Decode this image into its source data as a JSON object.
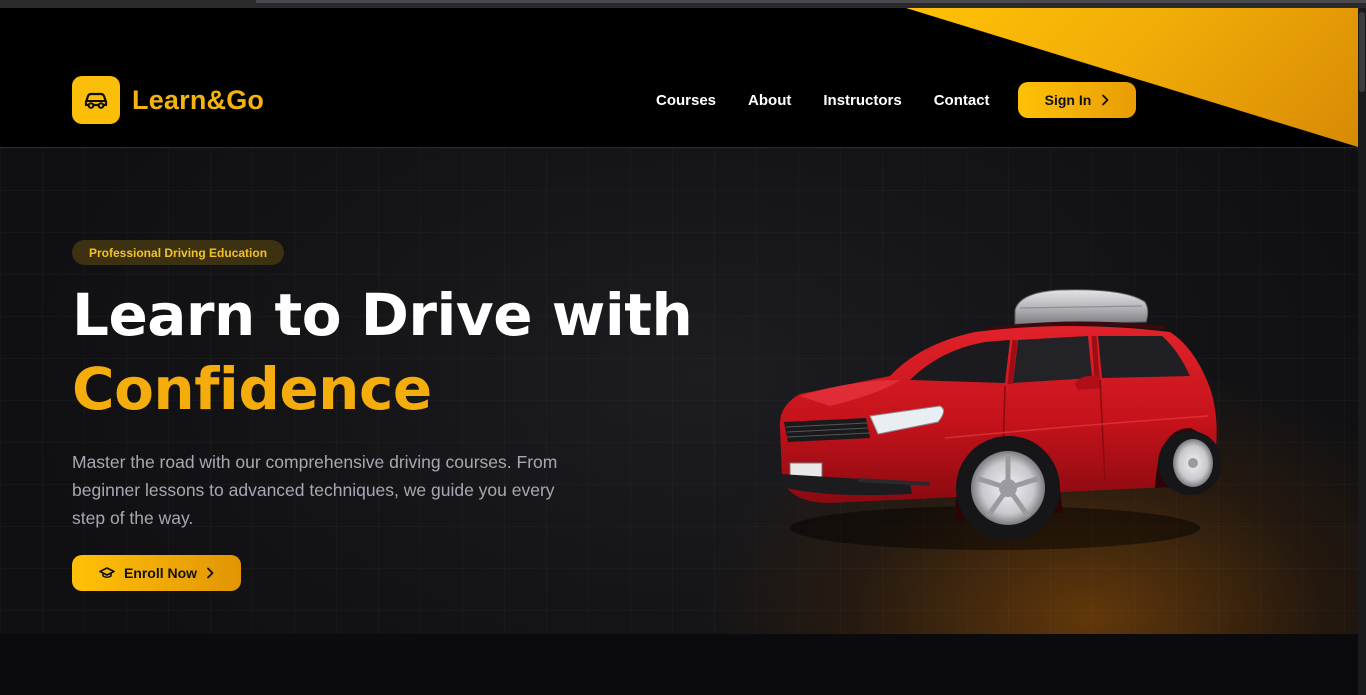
{
  "brand": {
    "name": "Learn&Go",
    "icon": "car-icon",
    "accent_color": "#f4b30d"
  },
  "nav": {
    "items": [
      {
        "label": "Courses"
      },
      {
        "label": "About"
      },
      {
        "label": "Instructors"
      },
      {
        "label": "Contact"
      }
    ],
    "signin_label": "Sign In",
    "signin_icon": "chevron-right-icon"
  },
  "hero": {
    "badge": "Professional Driving Education",
    "headline_line1": "Learn to Drive with",
    "headline_line2": "Confidence",
    "description": "Master the road with our comprehensive driving courses. From beginner lessons to advanced techniques, we guide you every step of the way.",
    "cta_label": "Enroll Now",
    "cta_icon": "graduation-cap-icon",
    "image": "red-car-with-roof-box"
  },
  "colors": {
    "background": "#0a0a0c",
    "accent": "#ffc107",
    "accent_dark": "#e29504",
    "text_muted": "#a8a8b3",
    "car_red": "#c5141c"
  }
}
